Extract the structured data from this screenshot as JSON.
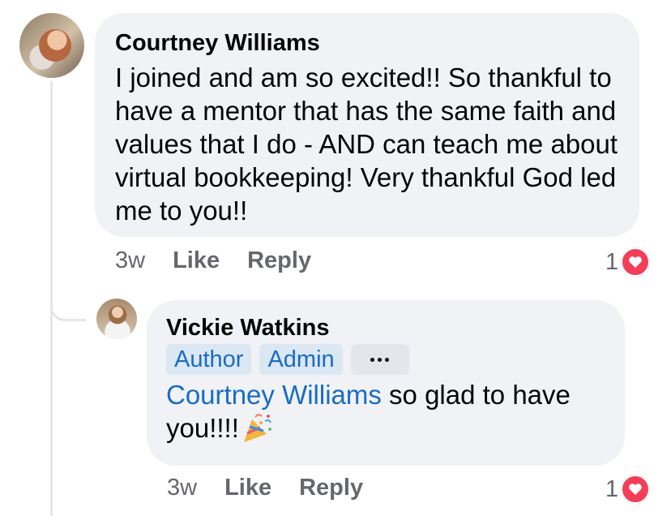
{
  "comments": [
    {
      "author": "Courtney Williams",
      "text": "I joined and am so excited!! So thankful to have a mentor that has the same faith and values that I do - AND can teach me about virtual bookkeeping! Very thankful God led me to you!!",
      "time": "3w",
      "like_label": "Like",
      "reply_label": "Reply",
      "reaction_count": "1",
      "reaction_icon": "heart-icon"
    }
  ],
  "replies": [
    {
      "author": "Vickie Watkins",
      "badges": [
        "Author",
        "Admin"
      ],
      "more_icon": "more-icon",
      "mention": "Courtney Williams",
      "text": " so glad to have you!!!!",
      "emoji_icon": "party-popper-icon",
      "time": "3w",
      "like_label": "Like",
      "reply_label": "Reply",
      "reaction_count": "1",
      "reaction_icon": "heart-icon"
    }
  ],
  "colors": {
    "bubble_bg": "#f0f2f5",
    "link_blue": "#1a6bc4",
    "badge_bg": "#dbe7f2",
    "meta_gray": "#65676b",
    "heart_red": "#f33e58"
  }
}
